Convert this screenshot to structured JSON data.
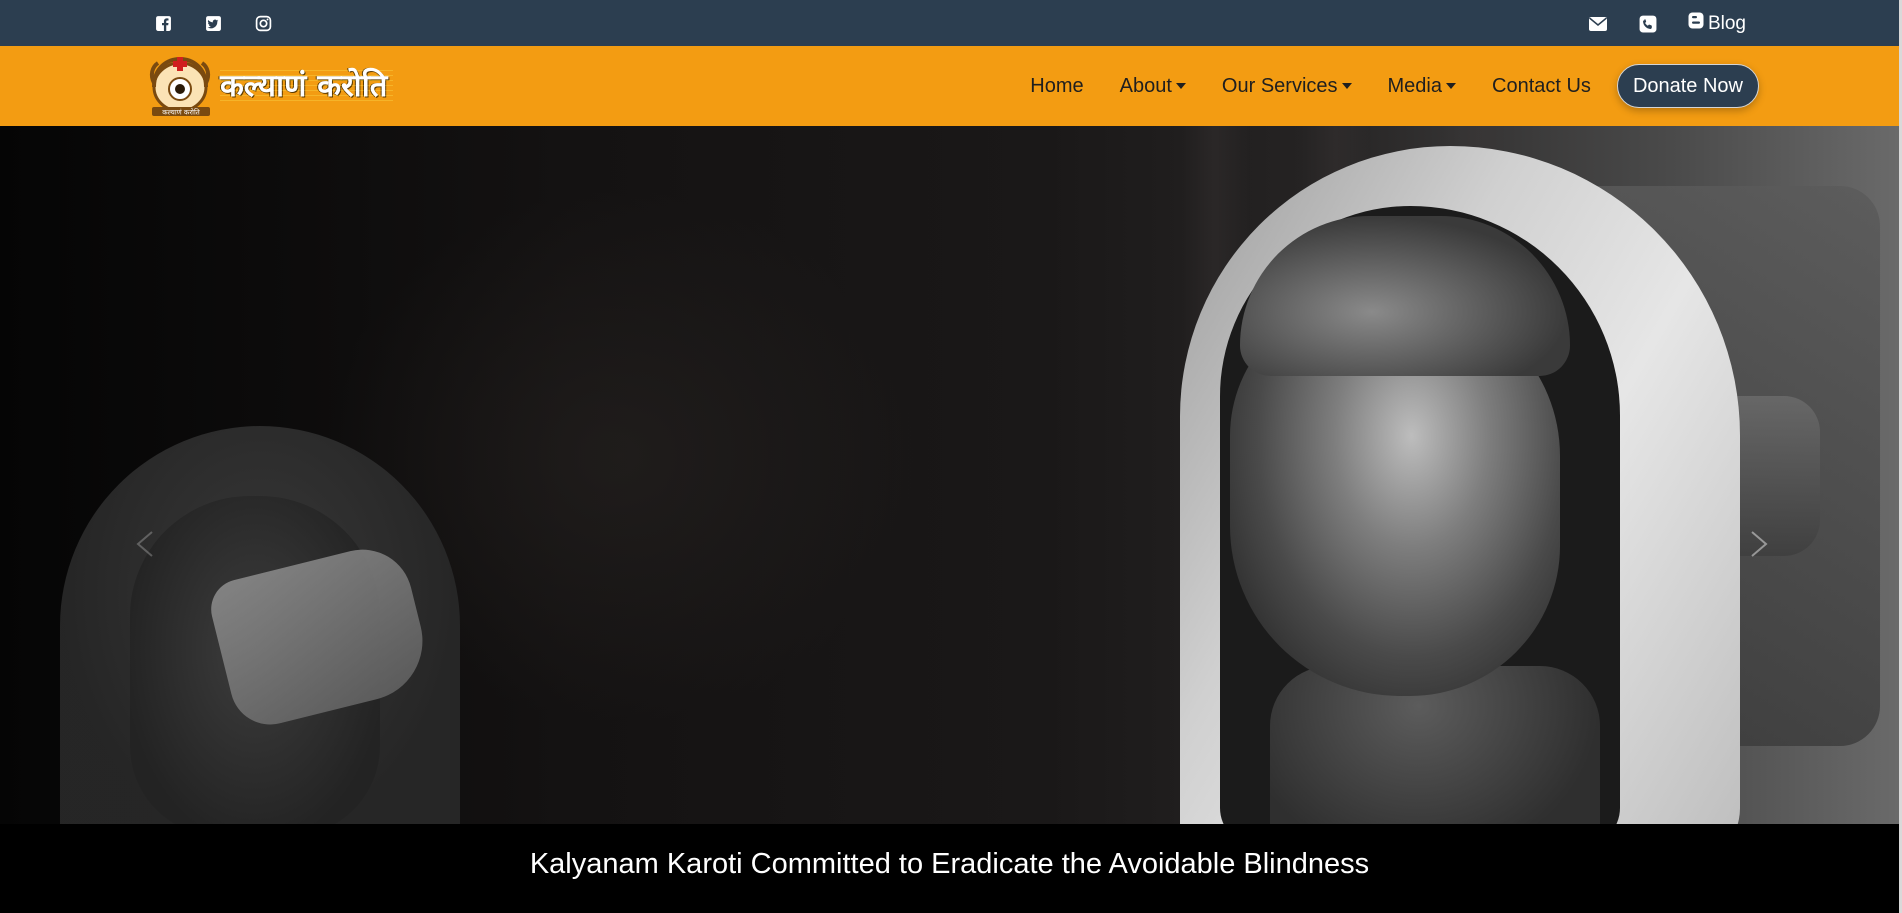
{
  "topbar": {
    "social": [
      {
        "icon": "facebook-icon"
      },
      {
        "icon": "twitter-icon"
      },
      {
        "icon": "instagram-icon"
      }
    ],
    "contact": [
      {
        "icon": "envelope-icon"
      },
      {
        "icon": "phone-icon"
      }
    ],
    "blog_label": "Blog"
  },
  "navbar": {
    "logo": {
      "wordmark": "कल्याणं करोति",
      "tagline": "कल्याणं करोति"
    },
    "items": [
      {
        "label": "Home",
        "dropdown": false
      },
      {
        "label": "About",
        "dropdown": true
      },
      {
        "label": "Our Services",
        "dropdown": true
      },
      {
        "label": "Media",
        "dropdown": true
      },
      {
        "label": "Contact Us",
        "dropdown": false
      }
    ],
    "donate_label": "Donate Now"
  },
  "hero": {
    "caption": "Kalyanam Karoti Committed to Eradicate the Avoidable Blindness"
  },
  "colors": {
    "topbar": "#2c3e50",
    "navbar": "#f39c12",
    "donate": "#2c3e50",
    "caption_bg": "#000000"
  }
}
